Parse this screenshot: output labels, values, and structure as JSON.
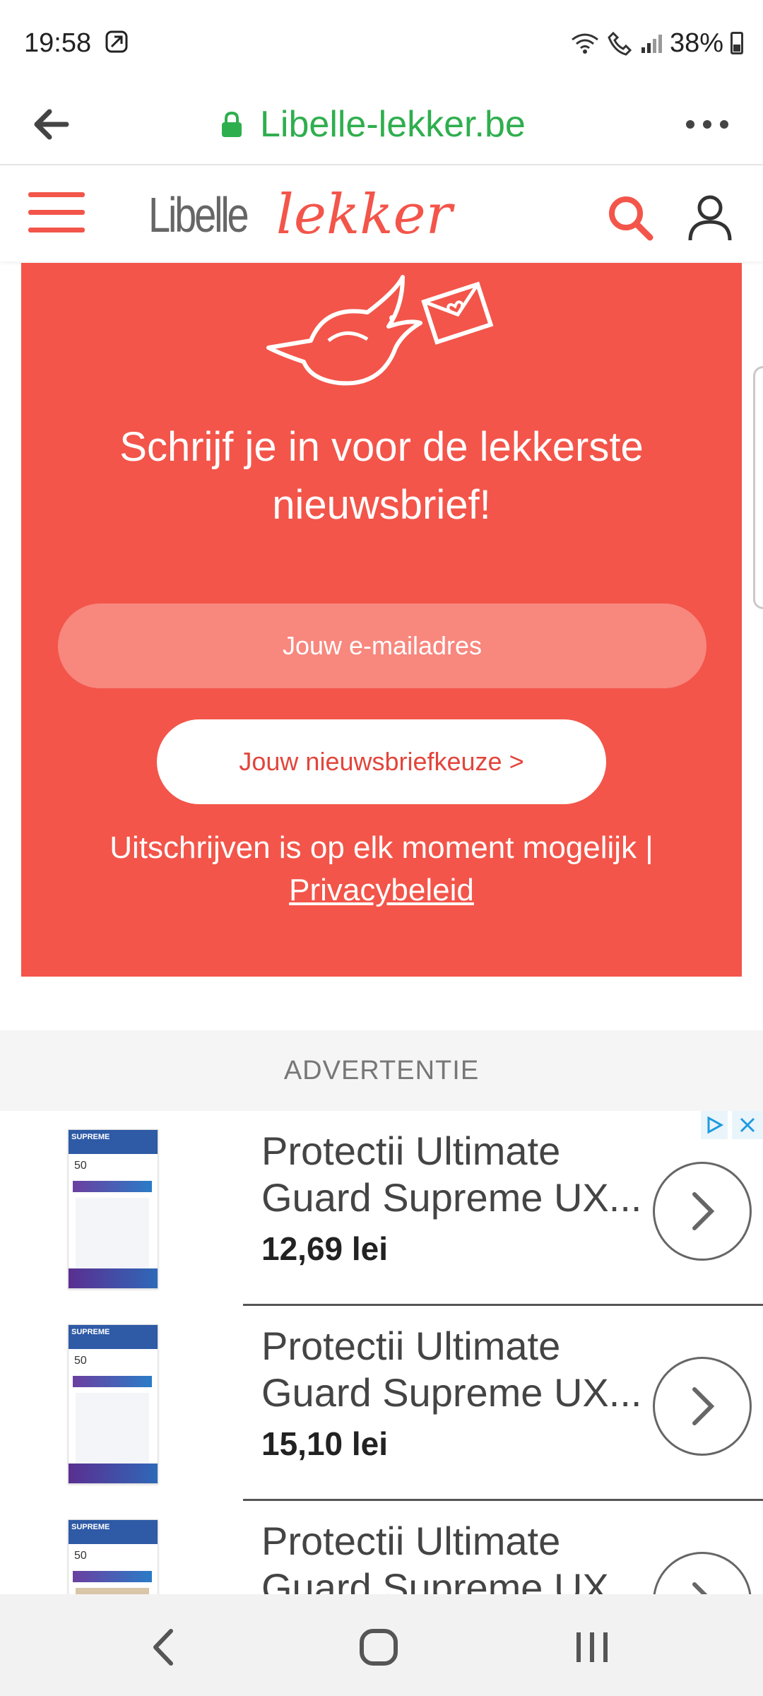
{
  "status_bar": {
    "time": "19:58",
    "battery": "38%"
  },
  "browser": {
    "url": "Libelle-lekker.be"
  },
  "site_header": {
    "logo_text_a": "Libelle",
    "logo_text_b": "lekker"
  },
  "newsletter": {
    "title": "Schrijf je in voor de lekkerste nieuwsbrief!",
    "email_placeholder": "Jouw e-mailadres",
    "choice_button": "Jouw nieuwsbriefkeuze >",
    "note": "Uitschrijven is op elk moment mogelijk |",
    "privacy_link": "Privacybeleid"
  },
  "ad": {
    "label": "ADVERTENTIE",
    "items": [
      {
        "title": "Protectii Ultimate Guard Supreme UX...",
        "price": "12,69 lei"
      },
      {
        "title": "Protectii Ultimate Guard Supreme UX...",
        "price": "15,10 lei"
      },
      {
        "title": "Protectii Ultimate Guard Supreme UX...",
        "price": ""
      }
    ],
    "product_badge": "SUPREME",
    "product_count": "50"
  },
  "colors": {
    "brand": "#f3554a",
    "url_green": "#2fae4e"
  }
}
